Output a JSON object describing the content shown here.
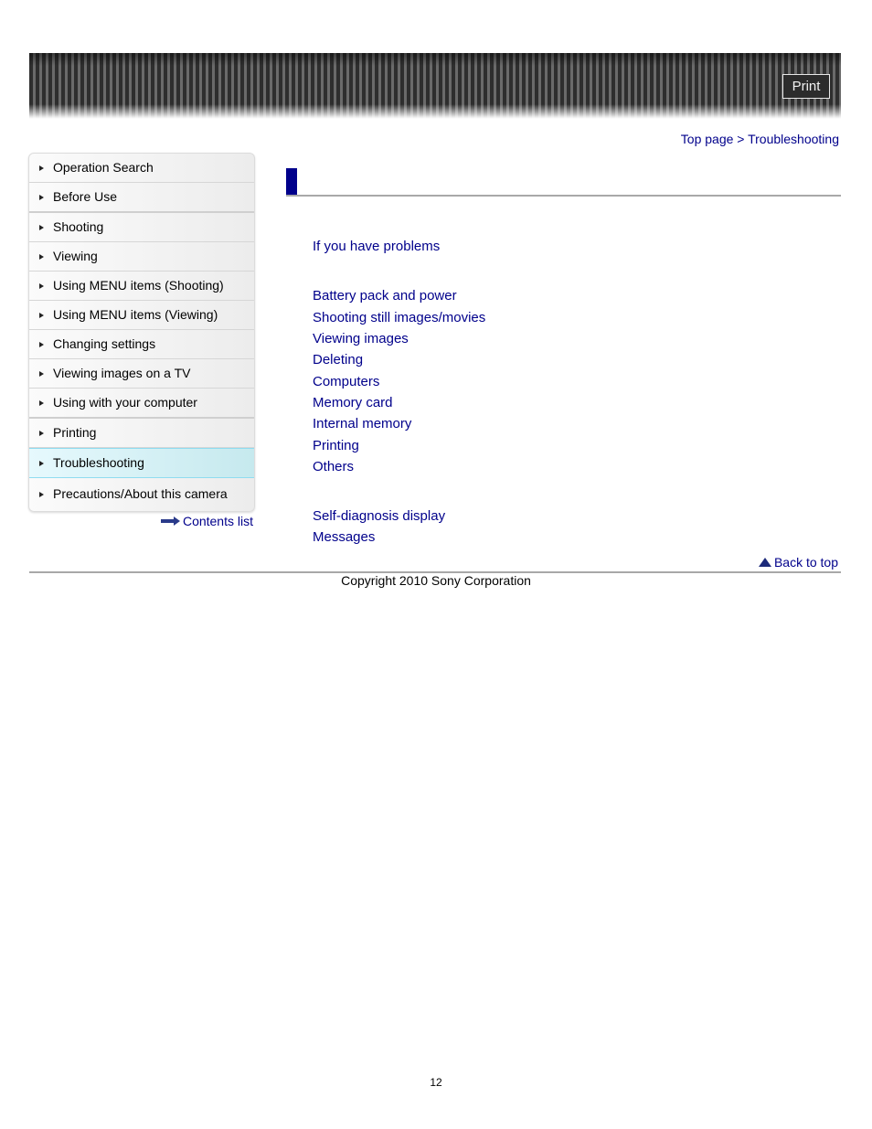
{
  "header": {
    "print_label": "Print"
  },
  "breadcrumb": {
    "home": "Top page",
    "separator": " > ",
    "current": "Troubleshooting"
  },
  "sidebar": {
    "items": [
      {
        "label": "Operation Search"
      },
      {
        "label": "Before Use"
      },
      {
        "label": "Shooting"
      },
      {
        "label": "Viewing"
      },
      {
        "label": "Using MENU items (Shooting)"
      },
      {
        "label": "Using MENU items (Viewing)"
      },
      {
        "label": "Changing settings"
      },
      {
        "label": "Viewing images on a TV"
      },
      {
        "label": "Using with your computer"
      },
      {
        "label": "Printing"
      },
      {
        "label": "Troubleshooting"
      },
      {
        "label": "Precautions/About this camera"
      }
    ],
    "active": "Troubleshooting",
    "contents_link": "Contents list"
  },
  "main": {
    "intro_link": "If you have problems",
    "topic_links": [
      "Battery pack and power",
      "Shooting still images/movies",
      "Viewing images",
      "Deleting",
      "Computers",
      "Memory card",
      "Internal memory",
      "Printing",
      "Others"
    ],
    "diagnosis_links": [
      "Self-diagnosis display",
      "Messages"
    ],
    "back_to_top": "Back to top"
  },
  "footer": {
    "copyright": "Copyright 2010 Sony Corporation",
    "page_number": "12"
  },
  "colors": {
    "link": "#00008b",
    "title_bar": "#00008b",
    "active_item": "#c6e9ee"
  }
}
